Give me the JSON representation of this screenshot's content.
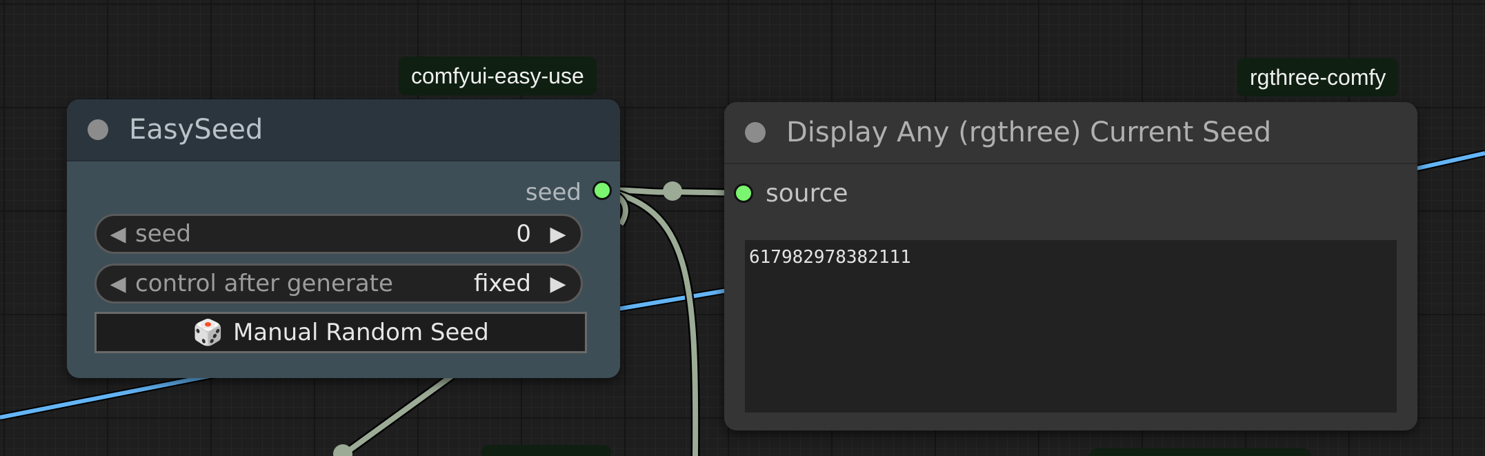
{
  "canvas": {
    "wire_colors": {
      "seed": "#9cab96",
      "link_blue": "#64b5f6"
    }
  },
  "badges": {
    "easy_seed_source": "comfyui-easy-use",
    "display_any_source": "rgthree-comfy"
  },
  "easy_seed_node": {
    "title": "EasySeed",
    "output_label": "seed",
    "seed_widget": {
      "label": "seed",
      "value": "0"
    },
    "control_widget": {
      "label": "control after generate",
      "value": "fixed"
    },
    "random_button_label": "Manual Random Seed",
    "random_button_icon": "dice-icon",
    "colors": {
      "title_bg": "#2b353d",
      "body_bg": "#3e4e56",
      "slot": "#7bf56f"
    }
  },
  "display_any_node": {
    "title": "Display Any (rgthree) Current Seed",
    "input_label": "source",
    "value": "617982978382111",
    "colors": {
      "title_bg": "#353535",
      "body_bg": "#353535"
    }
  }
}
